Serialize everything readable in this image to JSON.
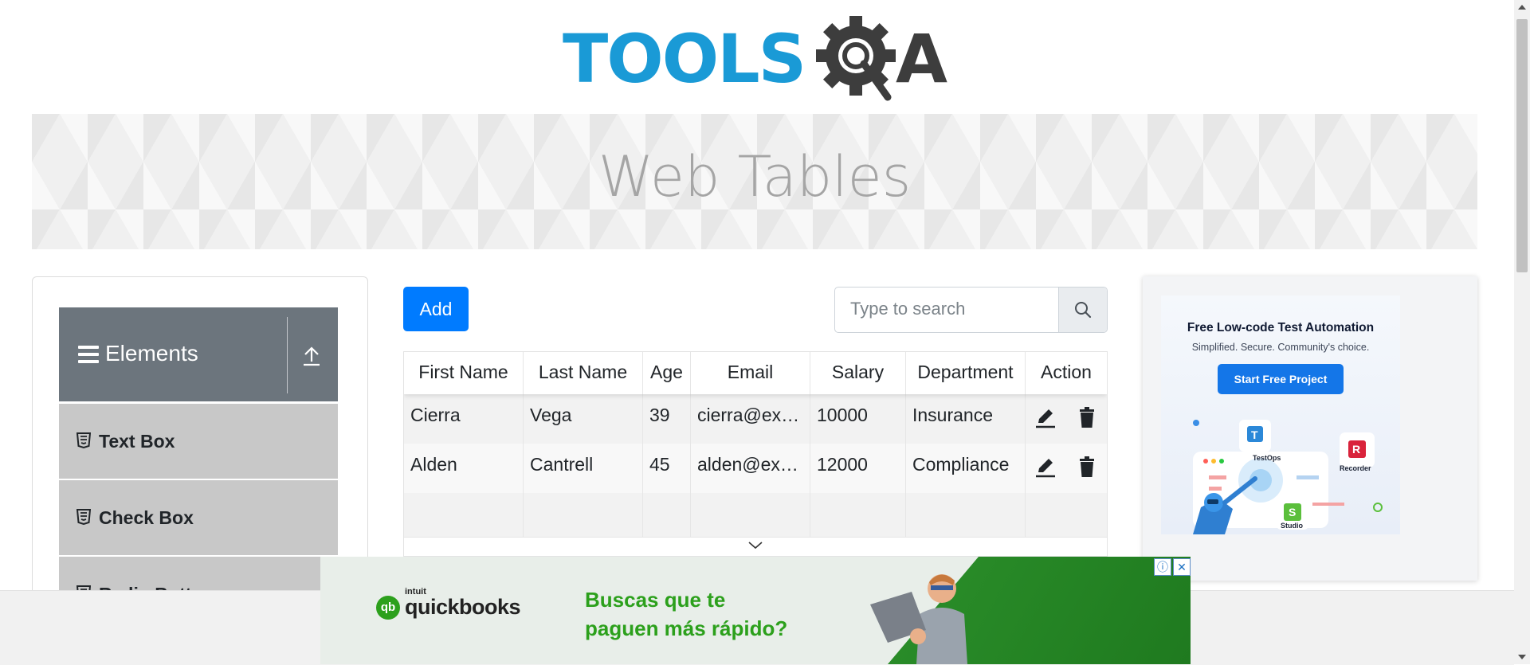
{
  "logo": {
    "text_main": "TOOLS",
    "text_tail": "A",
    "color_main": "#1a9ad6",
    "color_dark": "#3d3d3d"
  },
  "banner": {
    "title": "Web Tables"
  },
  "sidebar": {
    "group_title": "Elements",
    "items": [
      {
        "label": "Text Box",
        "icon": "html5-icon"
      },
      {
        "label": "Check Box",
        "icon": "html5-icon"
      },
      {
        "label": "Radio Button",
        "icon": "html5-icon"
      }
    ]
  },
  "toolbar": {
    "add_label": "Add",
    "search_placeholder": "Type to search"
  },
  "table": {
    "columns": [
      "First Name",
      "Last Name",
      "Age",
      "Email",
      "Salary",
      "Department",
      "Action"
    ],
    "rows": [
      [
        "Cierra",
        "Vega",
        "39",
        "cierra@ex…",
        "10000",
        "Insurance"
      ],
      [
        "Alden",
        "Cantrell",
        "45",
        "alden@ex…",
        "12000",
        "Compliance"
      ]
    ]
  },
  "ad_right": {
    "headline": "Free Low-code Test Automation",
    "sub": "Simplified. Secure. Community's choice.",
    "cta": "Start Free Project",
    "labels": [
      "TestOps",
      "Recorder",
      "Studio"
    ]
  },
  "ad_bottom": {
    "brand_small": "intuit",
    "brand": "quickbooks",
    "line1": "Buscas que te",
    "line2": "paguen más rápido?"
  },
  "colors": {
    "primary": "#007bff",
    "sidebar_header": "#6c757d",
    "sidebar_item": "#c8c8c8",
    "qb_green": "#2ca01c"
  }
}
